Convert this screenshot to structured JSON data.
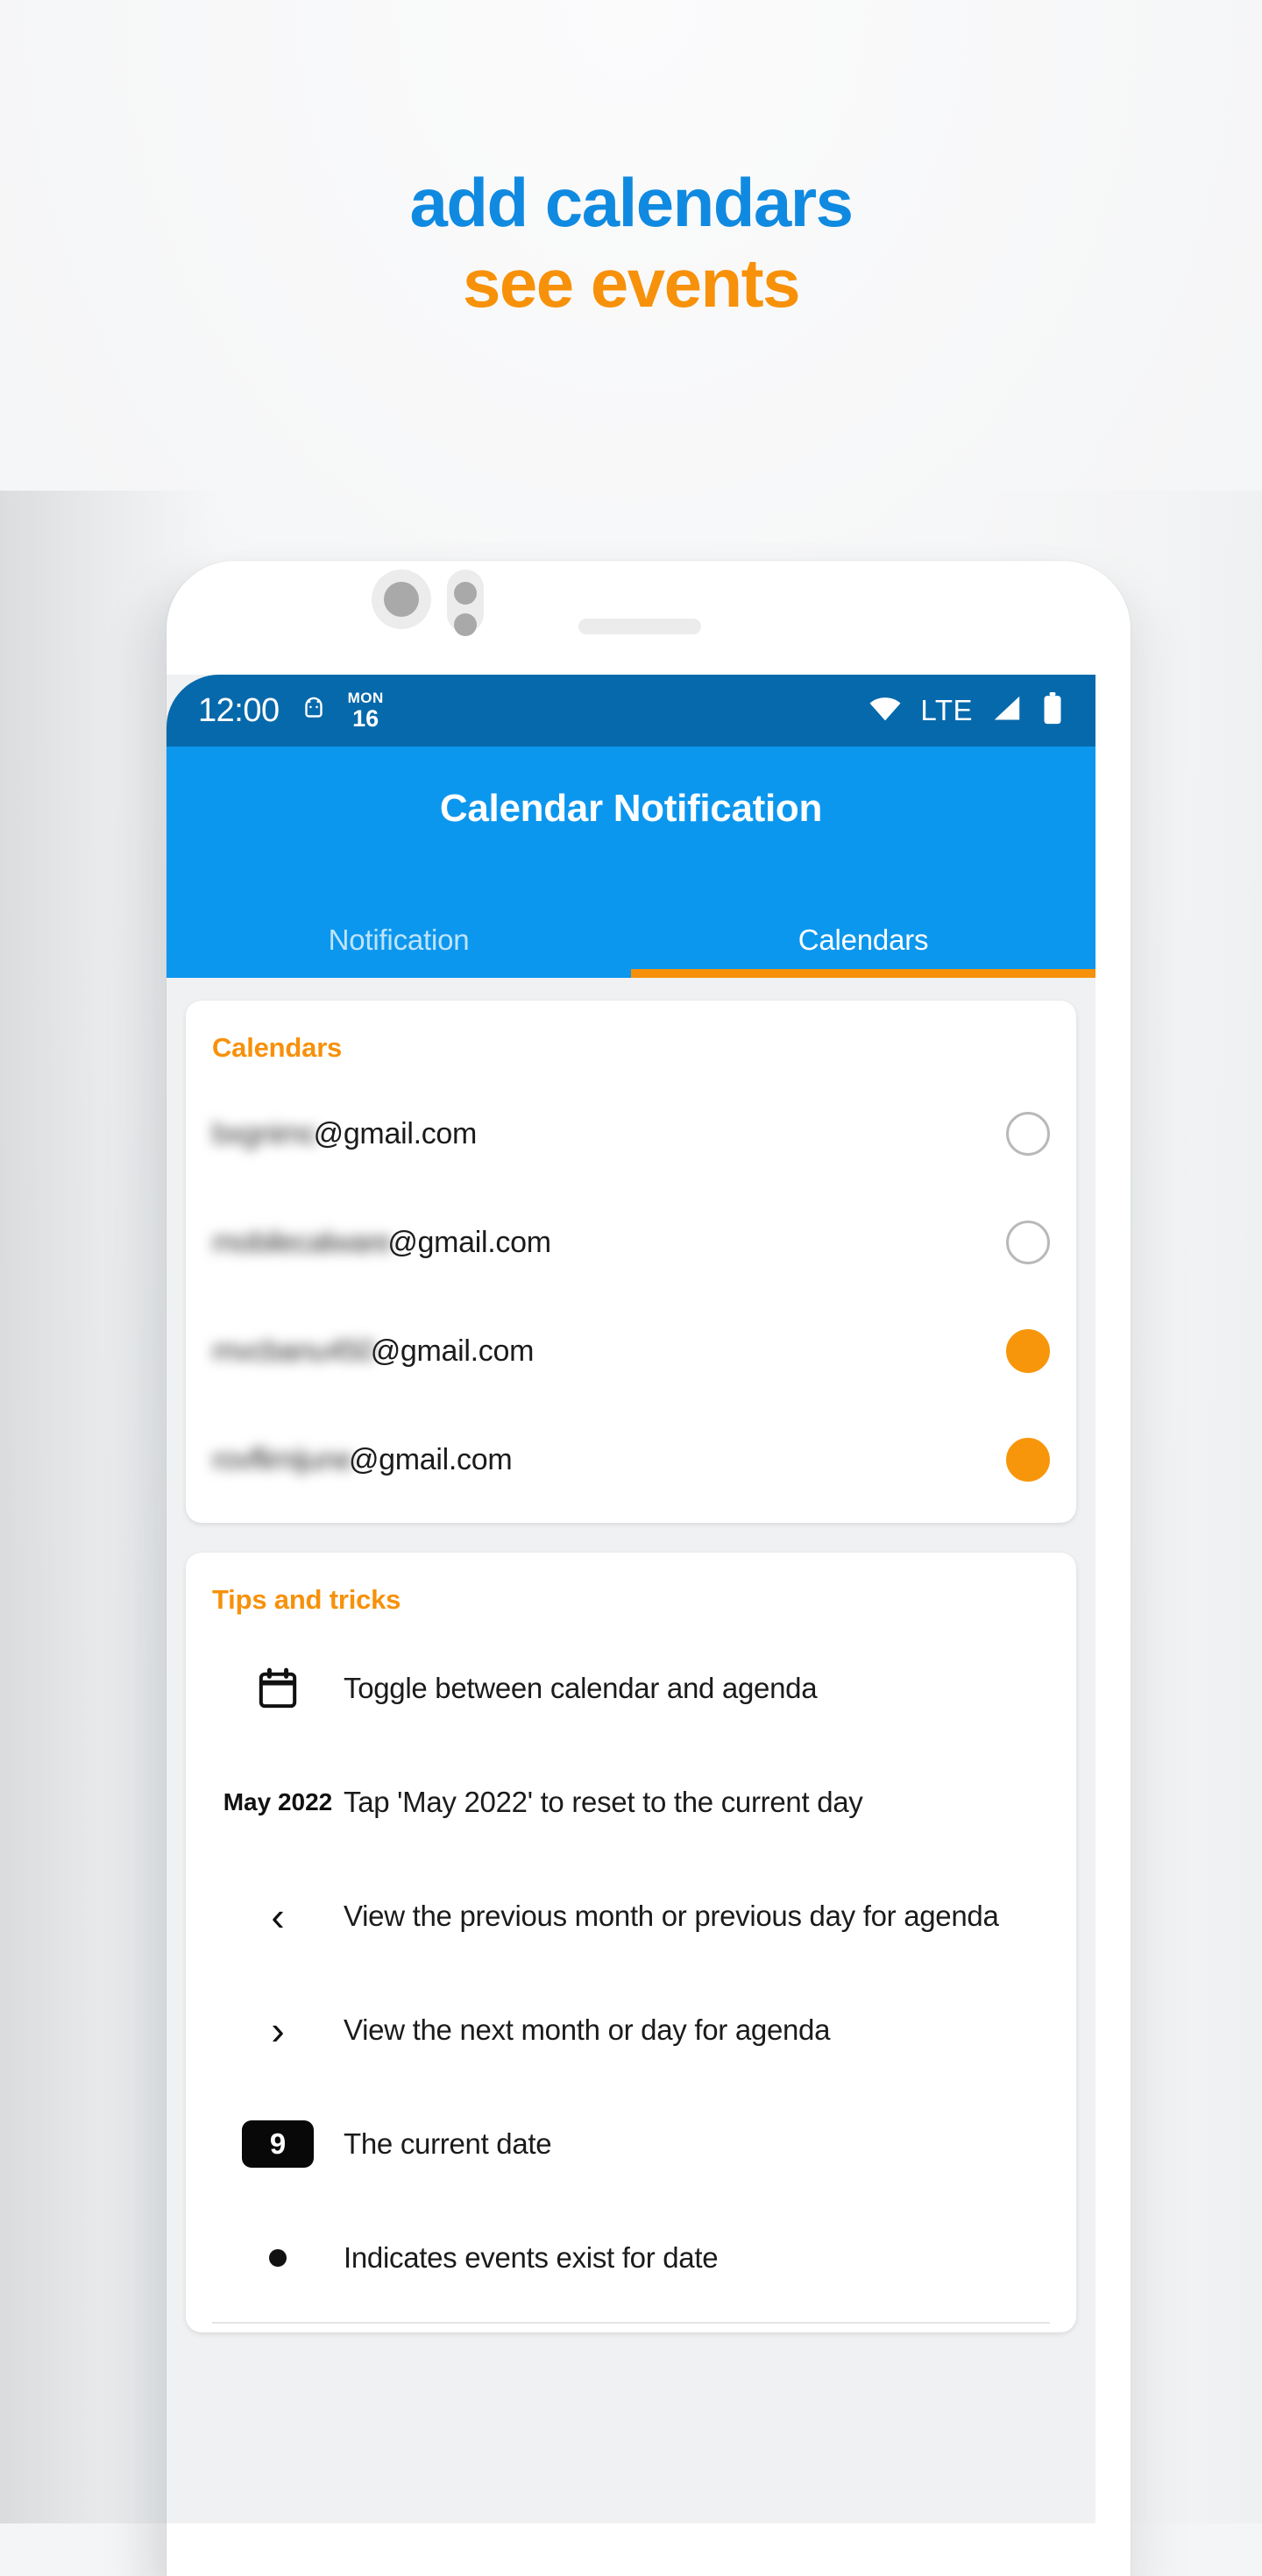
{
  "promo": {
    "line1": "add calendars",
    "line2": "see events",
    "color_blue": "#108ae0",
    "color_orange": "#f7910a"
  },
  "statusbar": {
    "time": "12:00",
    "android_icon": "android-robot-icon",
    "day_label": "MON",
    "day_number": "16",
    "wifi_icon": "wifi-icon",
    "network": "LTE",
    "signal_icon": "cell-signal-icon",
    "battery_icon": "battery-full-icon"
  },
  "appbar": {
    "title": "Calendar Notification"
  },
  "tabs": [
    {
      "label": "Notification",
      "active": false
    },
    {
      "label": "Calendars",
      "active": true
    }
  ],
  "calendars_card": {
    "title": "Calendars",
    "rows": [
      {
        "blurred_prefix": "bxgnimc",
        "suffix": "@gmail.com",
        "enabled": false
      },
      {
        "blurred_prefix": "mobilecalware",
        "suffix": "@gmail.com",
        "enabled": false
      },
      {
        "blurred_prefix": "mvcbanu450",
        "suffix": "@gmail.com",
        "enabled": true
      },
      {
        "blurred_prefix": "rovflimijune",
        "suffix": "@gmail.com",
        "enabled": true
      }
    ]
  },
  "tips_card": {
    "title": "Tips and tricks",
    "items": [
      {
        "icon": "calendar-icon",
        "icon_text": "",
        "text": "Toggle between calendar and agenda"
      },
      {
        "icon": "month-year-label",
        "icon_text": "May 2022",
        "text": "Tap 'May 2022' to reset to the current day"
      },
      {
        "icon": "chevron-left-icon",
        "icon_text": "‹",
        "text": "View the previous month or previous day for agenda"
      },
      {
        "icon": "chevron-right-icon",
        "icon_text": "›",
        "text": "View the next month or day for agenda"
      },
      {
        "icon": "current-date-badge",
        "icon_text": "9",
        "text": "The current date"
      },
      {
        "icon": "event-dot-icon",
        "icon_text": "",
        "text": "Indicates events exist for date"
      }
    ]
  }
}
